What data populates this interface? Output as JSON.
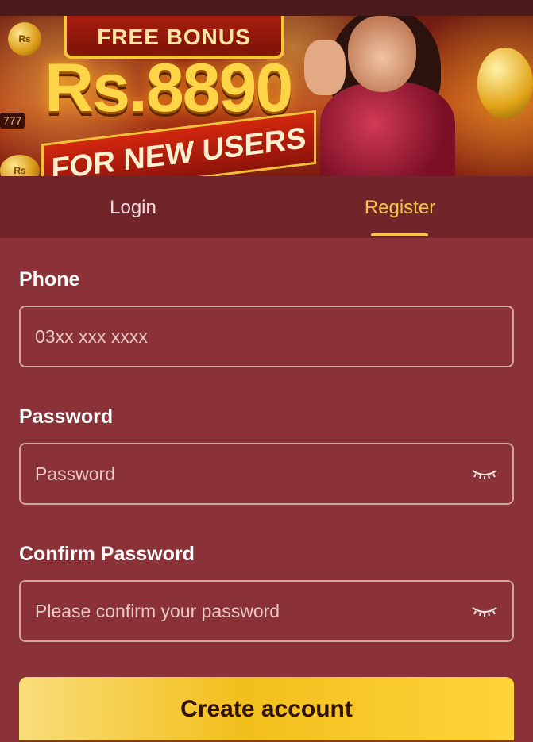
{
  "banner": {
    "bonus_text": "FREE BONUS",
    "amount": "Rs.8890",
    "ribbon_text": "FOR NEW USERS",
    "coin_label": "Rs",
    "slot_label": "777"
  },
  "tabs": {
    "login": "Login",
    "register": "Register",
    "active": "Register"
  },
  "form": {
    "phone_label": "Phone",
    "phone_placeholder": "03xx xxx xxxx",
    "password_label": "Password",
    "password_placeholder": "Password",
    "confirm_label": "Confirm Password",
    "confirm_placeholder": "Please confirm your password",
    "eye_icon": "eye-closed-icon"
  },
  "actions": {
    "create_account": "Create account"
  },
  "colors": {
    "accent": "#f6c449",
    "background": "#8a3237",
    "tab_bar": "#6f2529"
  }
}
